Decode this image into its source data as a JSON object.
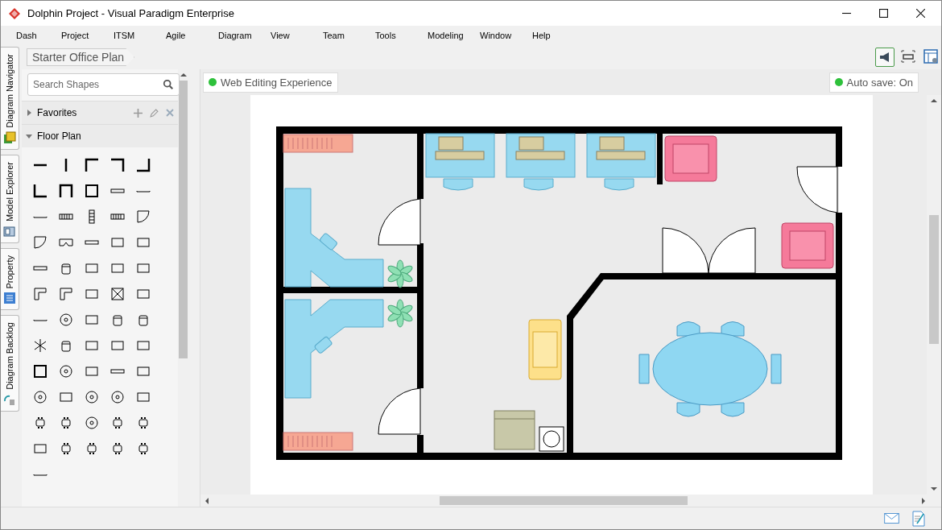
{
  "window": {
    "title": "Dolphin Project - Visual Paradigm Enterprise"
  },
  "menu": [
    "Dash",
    "Project",
    "ITSM",
    "Agile",
    "Diagram",
    "View",
    "Team",
    "Tools",
    "Modeling",
    "Window",
    "Help"
  ],
  "breadcrumb": "Starter Office Plan",
  "side_tabs": [
    {
      "label": "Diagram Navigator",
      "kind": "navigator"
    },
    {
      "label": "Model Explorer",
      "kind": "explorer"
    },
    {
      "label": "Property",
      "kind": "property"
    },
    {
      "label": "Diagram Backlog",
      "kind": "backlog"
    }
  ],
  "search": {
    "placeholder": "Search Shapes"
  },
  "sections": [
    {
      "label": "Favorites",
      "expanded": false,
      "kind": "favorites"
    },
    {
      "label": "Floor Plan",
      "expanded": true,
      "kind": "shapes"
    }
  ],
  "notices": [
    {
      "text": "Web Editing Experience"
    },
    {
      "text": "Auto save: On"
    }
  ]
}
